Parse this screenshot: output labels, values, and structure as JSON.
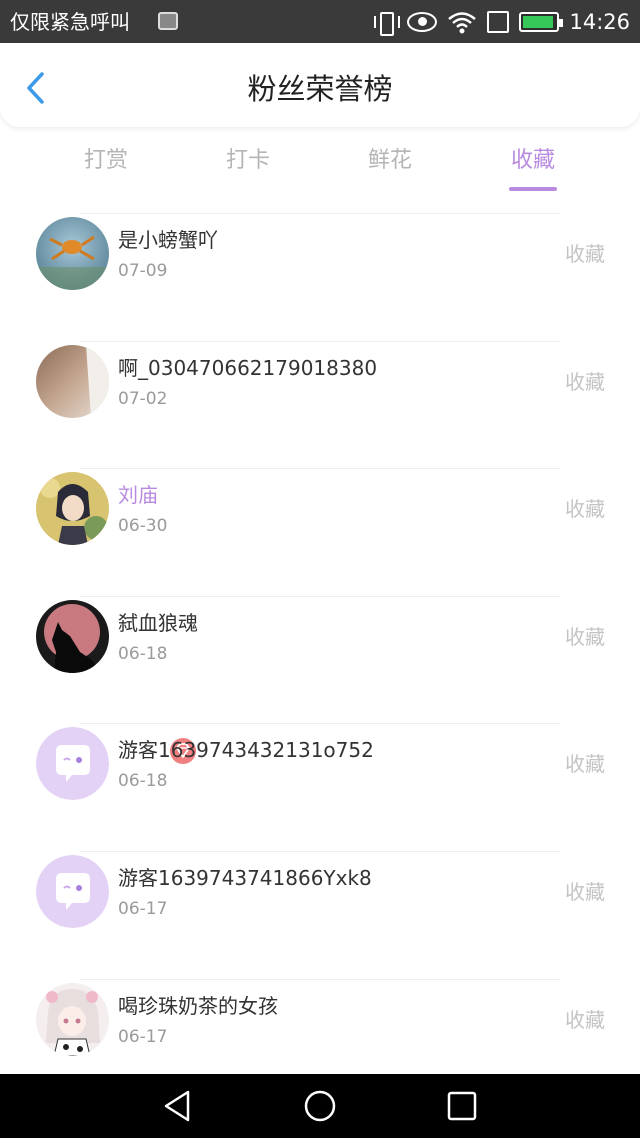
{
  "status_bar": {
    "carrier": "仅限紧急呼叫",
    "time": "14:26"
  },
  "header": {
    "title": "粉丝荣誉榜"
  },
  "tabs": [
    {
      "label": "打赏",
      "active": false
    },
    {
      "label": "打卡",
      "active": false
    },
    {
      "label": "鲜花",
      "active": false
    },
    {
      "label": "收藏",
      "active": true
    }
  ],
  "fans": [
    {
      "name": "是小螃蟹吖",
      "date": "07-09",
      "action": "收藏",
      "avatar": "crab-photo-avatar"
    },
    {
      "name": "啊_030470662179018380",
      "date": "07-02",
      "action": "收藏",
      "avatar": "blurred-photo-avatar"
    },
    {
      "name": "刘庙",
      "date": "06-30",
      "action": "收藏",
      "avatar": "anime-character-avatar",
      "vip": true
    },
    {
      "name": "弑血狼魂",
      "date": "06-18",
      "action": "收藏",
      "avatar": "wolf-moon-avatar"
    },
    {
      "name": "游客1639743432131o752",
      "date": "06-18",
      "action": "收藏",
      "avatar": "default-chat-avatar"
    },
    {
      "name": "游客1639743741866Yxk8",
      "date": "06-17",
      "action": "收藏",
      "avatar": "default-chat-avatar"
    },
    {
      "name": "喝珍珠奶茶的女孩",
      "date": "06-17",
      "action": "收藏",
      "avatar": "anime-girl-avatar"
    }
  ],
  "colors": {
    "accent": "#b88be0",
    "vip_badge": "#f08080",
    "muted": "#c4c4c4"
  }
}
